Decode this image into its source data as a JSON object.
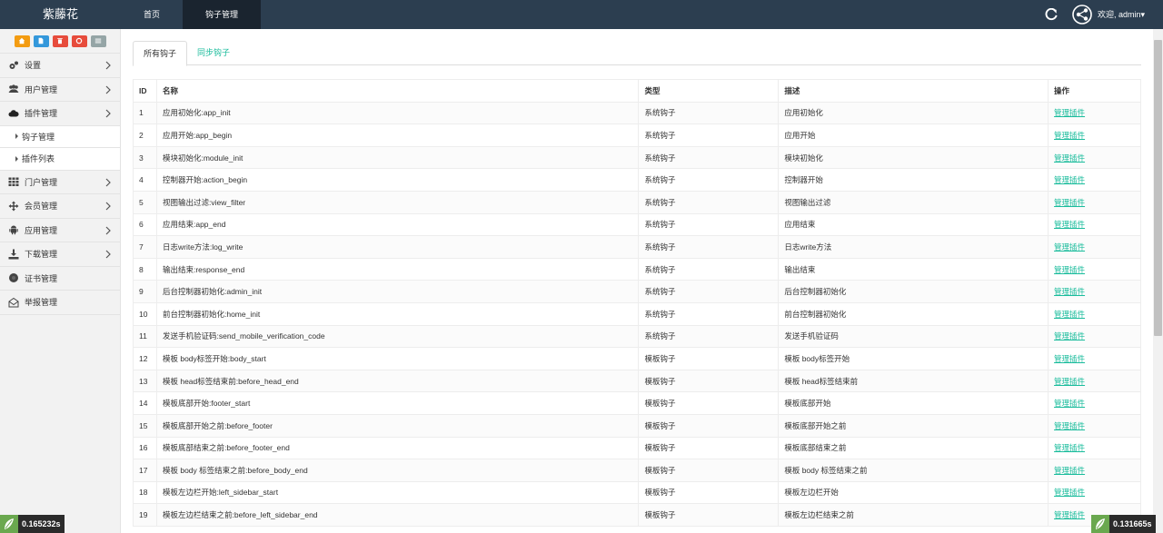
{
  "brand": "紫藤花",
  "topnav": [
    {
      "label": "首页",
      "active": false
    },
    {
      "label": "钩子管理",
      "active": true
    }
  ],
  "user": {
    "welcome": "欢迎, admin▾"
  },
  "shortcuts": [
    {
      "icon": "home-icon",
      "color": "#f39c12"
    },
    {
      "icon": "file-icon",
      "color": "#3498db"
    },
    {
      "icon": "trash-icon",
      "color": "#e74c3c"
    },
    {
      "icon": "recycle-icon",
      "color": "#e74c3c"
    },
    {
      "icon": "list-icon",
      "color": "#95a5a6"
    }
  ],
  "sidebar": {
    "items": [
      {
        "label": "设置",
        "icon": "cogs-icon"
      },
      {
        "label": "用户管理",
        "icon": "users-icon"
      },
      {
        "label": "插件管理",
        "icon": "cloud-icon",
        "active": true
      },
      {
        "label": "门户管理",
        "icon": "grid-icon"
      },
      {
        "label": "会员管理",
        "icon": "move-icon"
      },
      {
        "label": "应用管理",
        "icon": "android-icon"
      },
      {
        "label": "下载管理",
        "icon": "download-icon"
      },
      {
        "label": "证书管理",
        "icon": "certificate-icon"
      },
      {
        "label": "举报管理",
        "icon": "envelope-icon"
      }
    ],
    "sub_items": [
      {
        "label": "钩子管理"
      },
      {
        "label": "插件列表"
      }
    ]
  },
  "tabs": [
    {
      "label": "所有钩子",
      "active": true
    },
    {
      "label": "同步钩子",
      "active": false
    }
  ],
  "table": {
    "headers": [
      "ID",
      "名称",
      "类型",
      "描述",
      "操作"
    ],
    "rows": [
      {
        "id": "1",
        "name": "应用初始化:app_init",
        "type": "系统钩子",
        "desc": "应用初始化",
        "action": "管理插件"
      },
      {
        "id": "2",
        "name": "应用开始:app_begin",
        "type": "系统钩子",
        "desc": "应用开始",
        "action": "管理插件"
      },
      {
        "id": "3",
        "name": "模块初始化:module_init",
        "type": "系统钩子",
        "desc": "模块初始化",
        "action": "管理插件"
      },
      {
        "id": "4",
        "name": "控制器开始:action_begin",
        "type": "系统钩子",
        "desc": "控制器开始",
        "action": "管理插件"
      },
      {
        "id": "5",
        "name": "视图输出过滤:view_filter",
        "type": "系统钩子",
        "desc": "视图输出过滤",
        "action": "管理插件"
      },
      {
        "id": "6",
        "name": "应用结束:app_end",
        "type": "系统钩子",
        "desc": "应用结束",
        "action": "管理插件"
      },
      {
        "id": "7",
        "name": "日志write方法:log_write",
        "type": "系统钩子",
        "desc": "日志write方法",
        "action": "管理插件"
      },
      {
        "id": "8",
        "name": "输出结束:response_end",
        "type": "系统钩子",
        "desc": "输出结束",
        "action": "管理插件"
      },
      {
        "id": "9",
        "name": "后台控制器初始化:admin_init",
        "type": "系统钩子",
        "desc": "后台控制器初始化",
        "action": "管理插件"
      },
      {
        "id": "10",
        "name": "前台控制器初始化:home_init",
        "type": "系统钩子",
        "desc": "前台控制器初始化",
        "action": "管理插件"
      },
      {
        "id": "11",
        "name": "发送手机验证码:send_mobile_verification_code",
        "type": "系统钩子",
        "desc": "发送手机验证码",
        "action": "管理插件"
      },
      {
        "id": "12",
        "name": "模板 body标签开始:body_start",
        "type": "模板钩子",
        "desc": "模板 body标签开始",
        "action": "管理插件"
      },
      {
        "id": "13",
        "name": "模板 head标签结束前:before_head_end",
        "type": "模板钩子",
        "desc": "模板 head标签结束前",
        "action": "管理插件"
      },
      {
        "id": "14",
        "name": "模板底部开始:footer_start",
        "type": "模板钩子",
        "desc": "模板底部开始",
        "action": "管理插件"
      },
      {
        "id": "15",
        "name": "模板底部开始之前:before_footer",
        "type": "模板钩子",
        "desc": "模板底部开始之前",
        "action": "管理插件"
      },
      {
        "id": "16",
        "name": "模板底部结束之前:before_footer_end",
        "type": "模板钩子",
        "desc": "模板底部结束之前",
        "action": "管理插件"
      },
      {
        "id": "17",
        "name": "模板 body 标签结束之前:before_body_end",
        "type": "模板钩子",
        "desc": "模板 body 标签结束之前",
        "action": "管理插件"
      },
      {
        "id": "18",
        "name": "模板左边栏开始:left_sidebar_start",
        "type": "模板钩子",
        "desc": "模板左边栏开始",
        "action": "管理插件"
      },
      {
        "id": "19",
        "name": "模板左边栏结束之前:before_left_sidebar_end",
        "type": "模板钩子",
        "desc": "模板左边栏结束之前",
        "action": "管理插件"
      }
    ]
  },
  "timers": {
    "left": "0.165232s",
    "right": "0.131665s"
  },
  "colors": {
    "topbar": "#2c3e50",
    "link": "#1abc9c",
    "sidebar": "#f2f2f2"
  }
}
